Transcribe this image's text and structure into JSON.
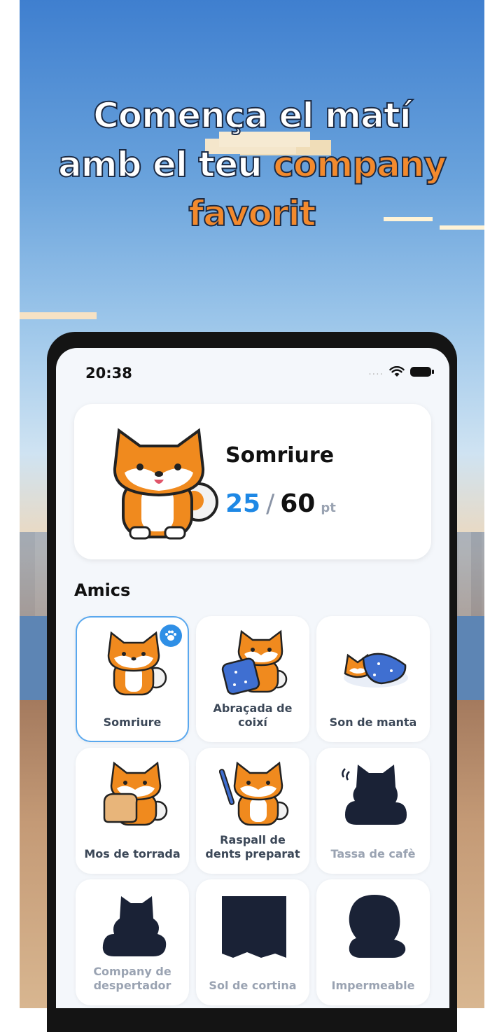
{
  "headline": {
    "line1": "Comença el matí",
    "line2_prefix": "amb el teu ",
    "line2_highlight": "company",
    "line3_highlight": "favorit"
  },
  "status_bar": {
    "time": "20:38",
    "signal": "...."
  },
  "hero": {
    "name": "Somriure",
    "score_current": "25",
    "score_separator": "/",
    "score_total": "60",
    "score_unit": "pt"
  },
  "friends": {
    "title": "Amics",
    "items": [
      {
        "label": "Somriure",
        "locked": false,
        "selected": true
      },
      {
        "label": "Abraçada de coixí",
        "locked": false,
        "selected": false
      },
      {
        "label": "Son de manta",
        "locked": false,
        "selected": false
      },
      {
        "label": "Mos de torrada",
        "locked": false,
        "selected": false
      },
      {
        "label": "Raspall de dents preparat",
        "locked": false,
        "selected": false
      },
      {
        "label": "Tassa de cafè",
        "locked": true,
        "selected": false
      },
      {
        "label": "Company de despertador",
        "locked": true,
        "selected": false
      },
      {
        "label": "Sol de cortina",
        "locked": true,
        "selected": false
      },
      {
        "label": "Impermeable",
        "locked": true,
        "selected": false
      }
    ]
  },
  "colors": {
    "accent": "#f38a2d",
    "blue": "#1e88e5",
    "badge": "#2f8fe6",
    "silhouette": "#1a2236"
  }
}
